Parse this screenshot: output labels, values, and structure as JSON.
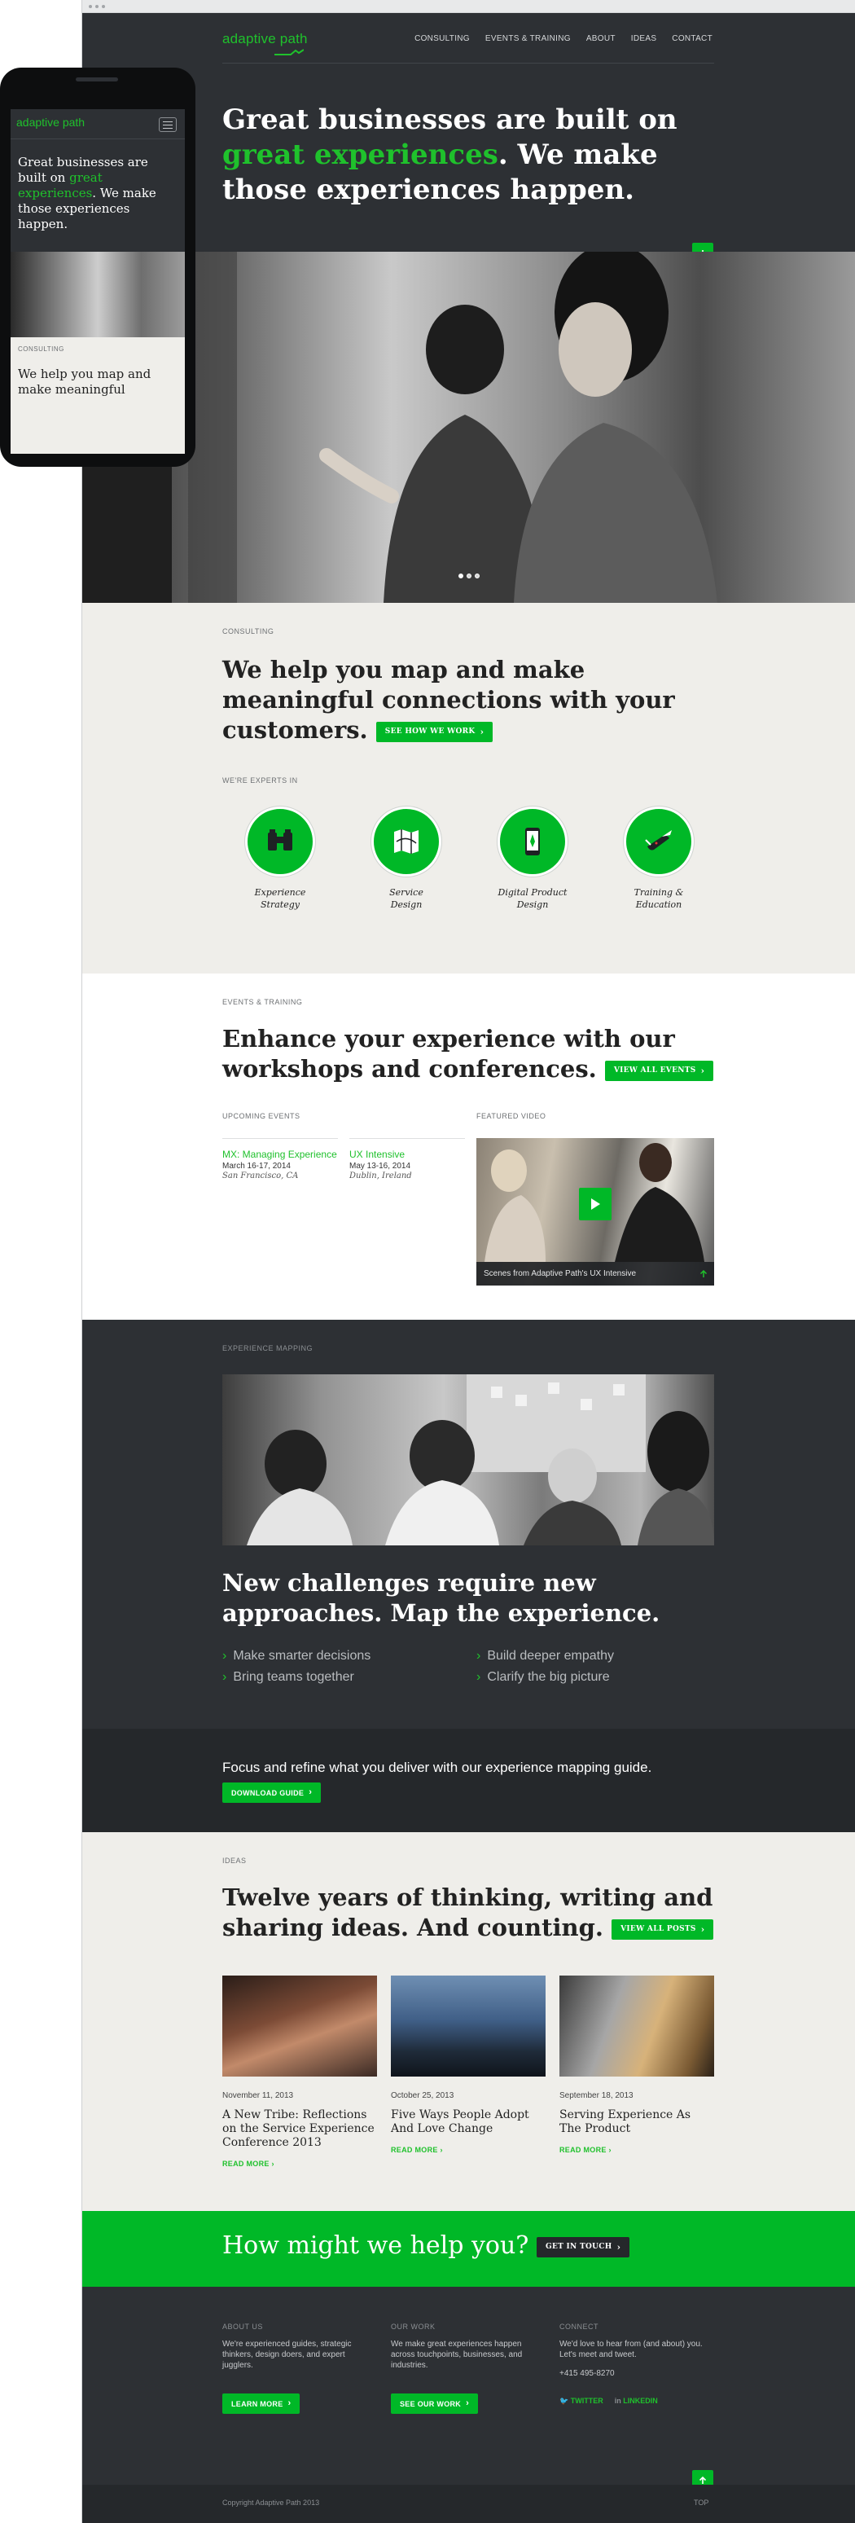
{
  "header": {
    "logo": "adaptive path",
    "nav": [
      "CONSULTING",
      "EVENTS & TRAINING",
      "ABOUT",
      "IDEAS",
      "CONTACT"
    ],
    "hero_pre": "Great businesses are built on",
    "hero_accent": "great experiences",
    "hero_post": ". We make those experiences happen."
  },
  "mobile": {
    "logo": "adaptive path",
    "hero_pre": "Great businesses are built on",
    "hero_accent": "great experiences",
    "hero_post": ". We make those experiences happen.",
    "eyebrow": "CONSULTING",
    "teaser": "We help you map and make meaningful"
  },
  "consulting": {
    "eyebrow": "CONSULTING",
    "heading": "We help you map and make meaningful connections with your customers.",
    "button": "SEE HOW WE WORK",
    "experts_eyebrow": "WE'RE EXPERTS IN",
    "experts": [
      {
        "label_1": "Experience",
        "label_2": "Strategy",
        "icon": "binoculars-icon"
      },
      {
        "label_1": "Service",
        "label_2": "Design",
        "icon": "map-icon"
      },
      {
        "label_1": "Digital Product",
        "label_2": "Design",
        "icon": "smartphone-compass-icon"
      },
      {
        "label_1": "Training &",
        "label_2": "Education",
        "icon": "pocket-knife-icon"
      }
    ]
  },
  "events": {
    "eyebrow": "EVENTS & TRAINING",
    "heading": "Enhance your experience with our workshops and conferences.",
    "button": "VIEW ALL EVENTS",
    "upcoming_label": "UPCOMING EVENTS",
    "featured_label": "FEATURED VIDEO",
    "items": [
      {
        "title": "MX: Managing Experience",
        "date": "March 16-17, 2014",
        "place": "San Francisco, CA"
      },
      {
        "title": "UX Intensive",
        "date": "May 13-16, 2014",
        "place": "Dublin, Ireland"
      }
    ],
    "video_caption": "Scenes from Adaptive Path's UX Intensive"
  },
  "mapping": {
    "eyebrow": "EXPERIENCE MAPPING",
    "heading": "New challenges require new approaches. Map the experience.",
    "bullets_left": [
      "Make smarter decisions",
      "Bring teams together"
    ],
    "bullets_right": [
      "Build deeper empathy",
      "Clarify the big picture"
    ],
    "guide_text": "Focus and refine what you deliver with our experience mapping guide.",
    "guide_button": "DOWNLOAD GUIDE"
  },
  "ideas": {
    "eyebrow": "IDEAS",
    "heading": "Twelve years of thinking, writing and sharing ideas. And counting.",
    "button": "VIEW ALL POSTS",
    "posts": [
      {
        "date": "November 11, 2013",
        "title": "A New Tribe: Reflections on the Service Experience Conference 2013",
        "read": "READ MORE"
      },
      {
        "date": "October 25, 2013",
        "title": "Five Ways People Adopt And Love Change",
        "read": "READ MORE"
      },
      {
        "date": "September 18, 2013",
        "title": "Serving Experience As The Product",
        "read": "READ MORE"
      }
    ]
  },
  "cta": {
    "heading": "How might we help you?",
    "button": "GET IN TOUCH"
  },
  "footer": {
    "about_label": "ABOUT US",
    "about_text": "We're experienced guides, strategic thinkers, design doers, and expert jugglers.",
    "about_button": "LEARN MORE",
    "work_label": "OUR WORK",
    "work_text": "We make great experiences happen across touchpoints, businesses, and industries.",
    "work_button": "SEE OUR WORK",
    "connect_label": "CONNECT",
    "connect_text": "We'd love to hear from (and about) you. Let's meet and tweet.",
    "phone": "+415 495-8270",
    "twitter": "TWITTER",
    "linkedin": "LINKEDIN",
    "copyright": "Copyright Adaptive Path 2013",
    "top": "TOP"
  },
  "colors": {
    "brand_green": "#00b827",
    "dark_bg": "#2d3034",
    "light_bg": "#efeeea"
  }
}
